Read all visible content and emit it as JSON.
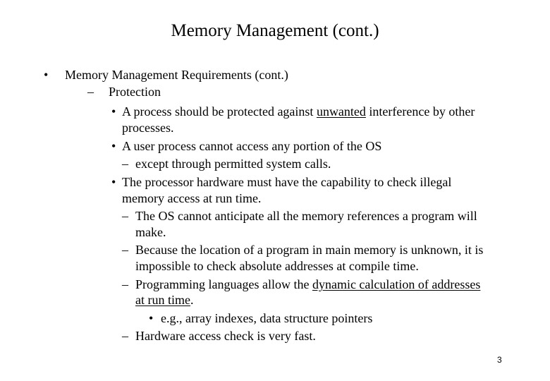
{
  "slide": {
    "title": "Memory Management (cont.)",
    "page_number": "3",
    "bullet_glyphs": {
      "dot": "•",
      "dash": "–"
    },
    "items": [
      {
        "text": "Memory Management Requirements (cont.)"
      },
      {
        "text": "Protection"
      },
      {
        "pre": "A process should be protected against ",
        "underlined": "unwanted",
        "post": " interference by other",
        "cont": "processes."
      },
      {
        "text": "A user process cannot access any portion of the OS"
      },
      {
        "text": "except through permitted system calls."
      },
      {
        "text": "The processor hardware must have the capability to check illegal",
        "cont": "memory access at run time."
      },
      {
        "text": "The OS cannot anticipate all the memory references a program will",
        "cont": "make."
      },
      {
        "text": "Because the location of a program in main memory is unknown, it is",
        "cont": "impossible to check absolute addresses at compile time."
      },
      {
        "pre": "Programming languages allow the ",
        "underlined": "dynamic calculation of addresses",
        "cont_underlined": "at run time",
        "cont_post": "."
      },
      {
        "text": "e.g., array indexes, data structure pointers"
      },
      {
        "text": "Hardware access check is very fast."
      }
    ]
  }
}
